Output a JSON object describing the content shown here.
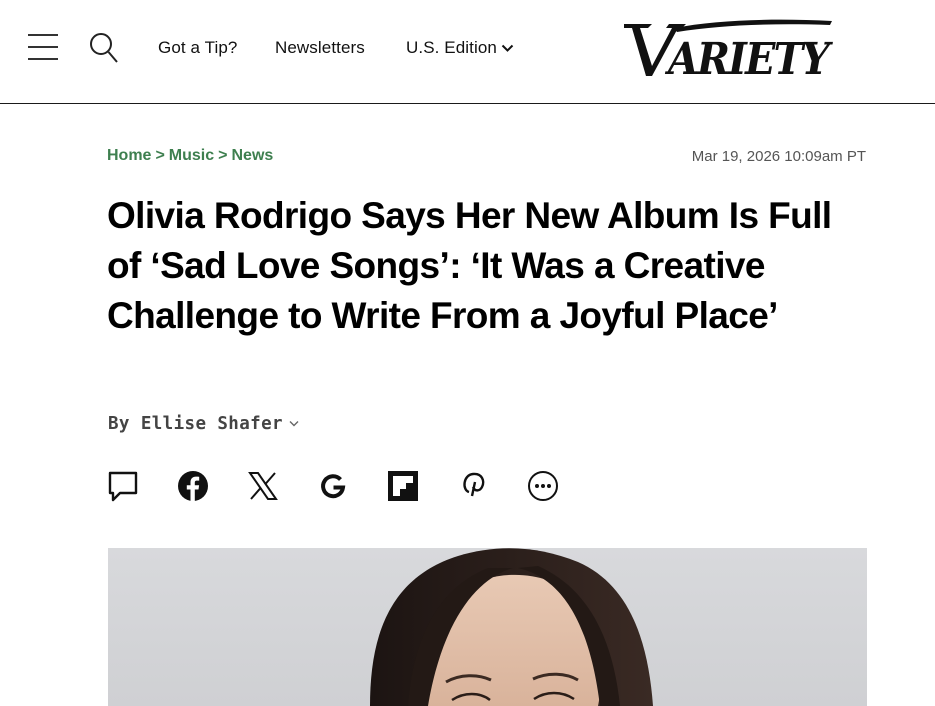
{
  "header": {
    "menu_icon": "hamburger-menu-icon",
    "search_icon": "search-icon",
    "tip_label": "Got a Tip?",
    "newsletters_label": "Newsletters",
    "edition_label": "U.S. Edition",
    "edition_icon": "chevron-down-icon",
    "logo_text": "VARIETY"
  },
  "breadcrumb": {
    "items": [
      "Home",
      "Music",
      "News"
    ],
    "separator": ">"
  },
  "article": {
    "date": "Mar 19, 2026 10:09am PT",
    "headline": "Olivia Rodrigo Says Her New Album Is Full of ‘Sad Love Songs’: ‘It Was a Creative Challenge to Write From a Joyful Place’",
    "byline_prefix": "By",
    "author": "Ellise Shafer"
  },
  "share": {
    "icons": [
      "comment-icon",
      "facebook-icon",
      "x-icon",
      "google-icon",
      "flipboard-icon",
      "pinterest-icon",
      "more-icon"
    ]
  },
  "colors": {
    "breadcrumb_green": "#3e7f4f",
    "text_black": "#000000",
    "meta_gray": "#555555"
  }
}
